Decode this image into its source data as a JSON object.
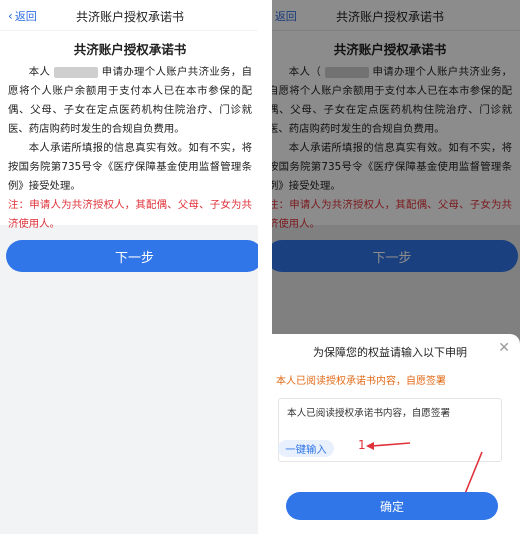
{
  "left_screen": {
    "nav": {
      "back_label": "返回",
      "title": "共济账户授权承诺书"
    },
    "document": {
      "heading": "共济账户授权承诺书",
      "para1_start": "本人",
      "para1_rest": "申请办理个人账户共济业务，自愿将个人账户余额用于支付本人已在本市参保的配偶、父母、子女在定点医药机构住院治疗、门诊就医、药店购药时发生的合规自负费用。",
      "para2": "本人承诺所填报的信息真实有效。如有不实，将按国务院第735号令《医疗保障基金使用监督管理条例》接受处理。",
      "note": "注：申请人为共济授权人，其配偶、父母、子女为共济使用人。"
    },
    "next_button": "下一步"
  },
  "right_screen": {
    "nav": {
      "back_label": "返回",
      "title": "共济账户授权承诺书"
    },
    "document": {
      "heading": "共济账户授权承诺书",
      "para1_start": "本人（",
      "para1_rest": "申请办理个人账户共济业务，自愿将个人账户余额用于支付本人已在本市参保的配偶、父母、子女在定点医药机构住院治疗、门诊就医、药店购药时发生的合规自负费用。",
      "para2": "本人承诺所填报的信息真实有效。如有不实，将按国务院第735号令《医疗保障基金使用监督管理条例》接受处理。",
      "note": "注：申请人为共济授权人，其配偶、父母、子女为共济使用人。"
    },
    "next_button": "下一步",
    "sheet": {
      "title": "为保障您的权益请输入以下申明",
      "instruction": "本人已阅读授权承诺书内容，自愿签署",
      "input_value": "本人已阅读授权承诺书内容，自愿签署",
      "one_click_button": "一键输入",
      "annotation_number": "1",
      "confirm_button": "确定"
    }
  },
  "colors": {
    "primary": "#3176e8",
    "warning": "#e0323a",
    "instruction": "#e26a17"
  },
  "icons": {
    "back": "chevron-left-icon",
    "close": "close-icon"
  }
}
